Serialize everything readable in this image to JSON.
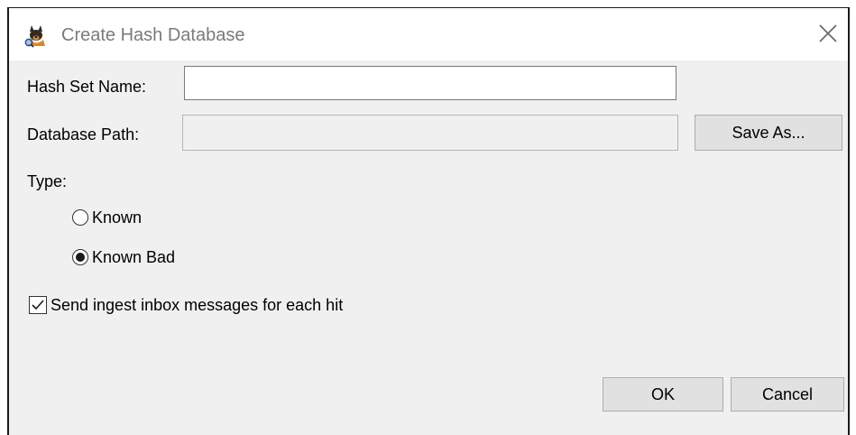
{
  "window": {
    "title": "Create Hash Database",
    "icon": "autopsy-dog-icon",
    "close_icon": "close-icon"
  },
  "form": {
    "hash_set_name_label": "Hash Set Name:",
    "hash_set_name_value": "",
    "database_path_label": "Database Path:",
    "database_path_value": "",
    "save_as_label": "Save As...",
    "type_label": "Type:",
    "type_options": [
      {
        "label": "Known",
        "selected": false
      },
      {
        "label": "Known Bad",
        "selected": true
      }
    ],
    "send_ingest_label": "Send ingest inbox messages for each hit",
    "send_ingest_checked": true
  },
  "buttons": {
    "ok_label": "OK",
    "cancel_label": "Cancel"
  }
}
